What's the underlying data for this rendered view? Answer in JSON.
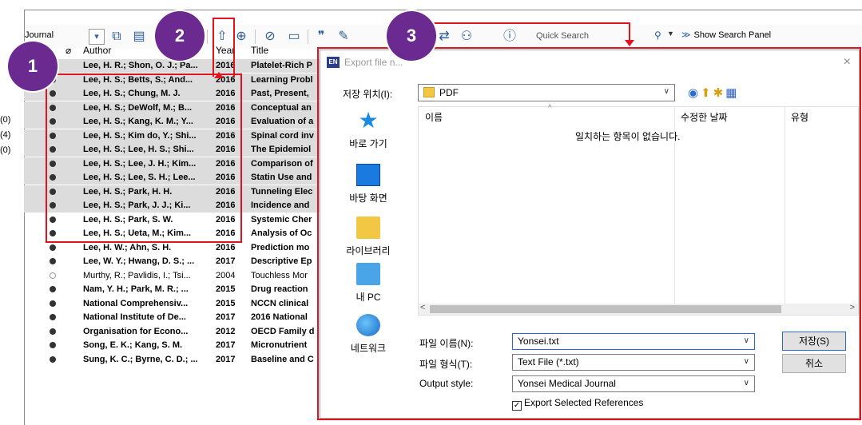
{
  "toolbar": {
    "library_label": "Journal",
    "quick_search_placeholder": "Quick Search",
    "show_search_panel": "Show Search Panel",
    "icons": [
      "collapse-icon",
      "online-mode-icon",
      "integrated-icon",
      "export-icon",
      "find-fulltext-icon",
      "link-icon",
      "folder-icon",
      "insert-citation-icon",
      "format-bibliography-icon",
      "word-icon",
      "share-icon",
      "add-user-icon",
      "help-icon",
      "search-icon",
      "show-panel-icon"
    ]
  },
  "group_counts": [
    "(0)",
    "(4)",
    "(0)"
  ],
  "reference_list": {
    "columns": [
      "Author",
      "Year",
      "Title"
    ],
    "rows": [
      {
        "author": "Lee, H. R.; Shon, O. J.; Pa...",
        "year": "2016",
        "title": "Platelet-Rich P",
        "selected": true,
        "read": true
      },
      {
        "author": "Lee, H. S.; Betts, S.; And...",
        "year": "2016",
        "title": "Learning Probl",
        "selected": true,
        "read": true
      },
      {
        "author": "Lee, H. S.; Chung, M. J.",
        "year": "2016",
        "title": "Past, Present,",
        "selected": true,
        "read": true
      },
      {
        "author": "Lee, H. S.; DeWolf, M.; B...",
        "year": "2016",
        "title": "Conceptual an",
        "selected": true,
        "read": true
      },
      {
        "author": "Lee, H. S.; Kang, K. M.; Y...",
        "year": "2016",
        "title": "Evaluation of a",
        "selected": true,
        "read": true
      },
      {
        "author": "Lee, H. S.; Kim do, Y.; Shi...",
        "year": "2016",
        "title": "Spinal cord inv",
        "selected": true,
        "read": true
      },
      {
        "author": "Lee, H. S.; Lee, H. S.; Shi...",
        "year": "2016",
        "title": "The Epidemiol",
        "selected": true,
        "read": true
      },
      {
        "author": "Lee, H. S.; Lee, J. H.; Kim...",
        "year": "2016",
        "title": "Comparison of",
        "selected": true,
        "read": true
      },
      {
        "author": "Lee, H. S.; Lee, S. H.; Lee...",
        "year": "2016",
        "title": "Statin Use and",
        "selected": true,
        "read": true
      },
      {
        "author": "Lee, H. S.; Park, H. H.",
        "year": "2016",
        "title": "Tunneling Elec",
        "selected": true,
        "read": true
      },
      {
        "author": "Lee, H. S.; Park, J. J.; Ki...",
        "year": "2016",
        "title": "Incidence and",
        "selected": true,
        "read": true
      },
      {
        "author": "Lee, H. S.; Park, S. W.",
        "year": "2016",
        "title": "Systemic Cher",
        "selected": false,
        "read": true
      },
      {
        "author": "Lee, H. S.; Ueta, M.; Kim...",
        "year": "2016",
        "title": "Analysis of Oc",
        "selected": false,
        "read": true
      },
      {
        "author": "Lee, H. W.; Ahn, S. H.",
        "year": "2016",
        "title": "Prediction mo",
        "selected": false,
        "read": true
      },
      {
        "author": "Lee, W. Y.; Hwang, D. S.; ...",
        "year": "2017",
        "title": "Descriptive Ep",
        "selected": false,
        "read": true
      },
      {
        "author": "Murthy, R.; Pavlidis, I.; Tsi...",
        "year": "2004",
        "title": "Touchless Mor",
        "selected": false,
        "read": false
      },
      {
        "author": "Nam, Y. H.; Park, M. R.; ...",
        "year": "2015",
        "title": "Drug reaction",
        "selected": false,
        "read": true
      },
      {
        "author": "National Comprehensiv...",
        "year": "2015",
        "title": "NCCN clinical",
        "selected": false,
        "read": true
      },
      {
        "author": "National Institute of De...",
        "year": "2017",
        "title": "2016 National",
        "selected": false,
        "read": true
      },
      {
        "author": "Organisation for Econo...",
        "year": "2012",
        "title": "OECD Family d",
        "selected": false,
        "read": true
      },
      {
        "author": "Song, E. K.; Kang, S. M.",
        "year": "2017",
        "title": "Micronutrient",
        "selected": false,
        "read": true
      },
      {
        "author": "Sung, K. C.; Byrne, C. D.; ...",
        "year": "2017",
        "title": "Baseline and C",
        "selected": false,
        "read": true
      }
    ]
  },
  "badges": [
    "1",
    "2",
    "3"
  ],
  "dialog": {
    "title": "Export file n...",
    "title_icon": "EN",
    "close_glyph": "×",
    "save_in_label": "저장 위치(I):",
    "save_in_value": "PDF",
    "places": [
      "바로 가기",
      "바탕 화면",
      "라이브러리",
      "내 PC",
      "네트워크"
    ],
    "columns": [
      "이름",
      "수정한 날짜",
      "유형"
    ],
    "empty_message": "일치하는 항목이 없습니다.",
    "file_name_label": "파일 이름(N):",
    "file_name_value": "Yonsei.txt",
    "file_type_label": "파일 형식(T):",
    "file_type_value": "Text File (*.txt)",
    "output_style_label": "Output style:",
    "output_style_value": "Yonsei Medical Journal",
    "export_selected_label": "Export Selected References",
    "export_selected_checked": true,
    "save_button": "저장(S)",
    "cancel_button": "취소"
  },
  "colors": {
    "highlight": "#e0141e",
    "badge": "#6a2a8f",
    "selection": "#dcdcdc"
  }
}
